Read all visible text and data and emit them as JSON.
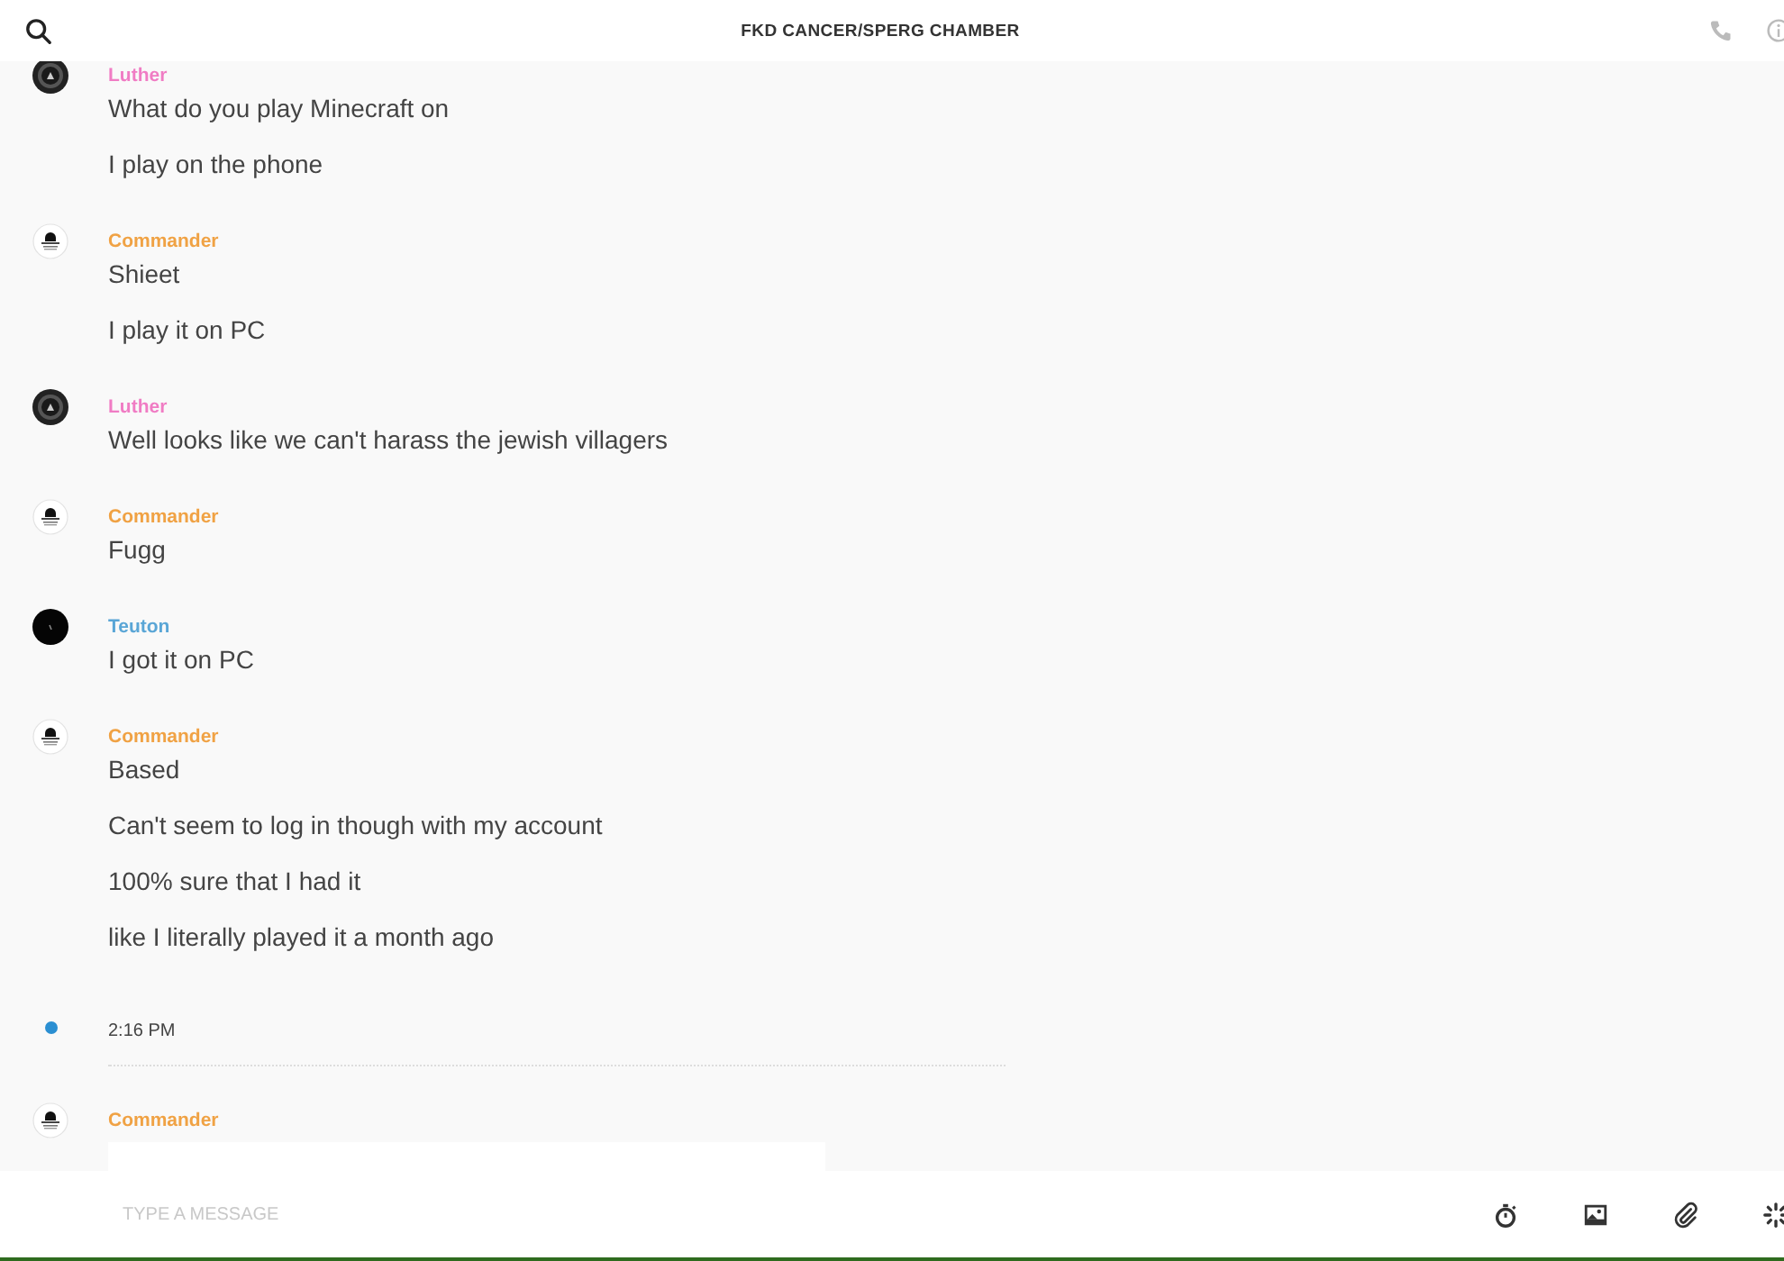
{
  "header": {
    "title": "FKD CANCER/SPERG CHAMBER"
  },
  "feed": [
    {
      "kind": "group",
      "author": "Luther",
      "color": "#f07cc4",
      "avatar": {
        "kind": "ring"
      },
      "messages": [
        {
          "kind": "text",
          "text": "What do you play Minecraft on"
        },
        {
          "kind": "text",
          "text": "I play on the phone"
        }
      ]
    },
    {
      "kind": "group",
      "author": "Commander",
      "color": "#f0a244",
      "avatar": {
        "kind": "figure"
      },
      "messages": [
        {
          "kind": "text",
          "text": "Shieet"
        },
        {
          "kind": "text",
          "text": "I play it on PC"
        }
      ]
    },
    {
      "kind": "group",
      "author": "Luther",
      "color": "#f07cc4",
      "avatar": {
        "kind": "ring"
      },
      "messages": [
        {
          "kind": "text",
          "text": "Well looks like we can't harass the jewish villagers"
        }
      ]
    },
    {
      "kind": "group",
      "author": "Commander",
      "color": "#f0a244",
      "avatar": {
        "kind": "figure"
      },
      "messages": [
        {
          "kind": "text",
          "text": "Fugg"
        }
      ]
    },
    {
      "kind": "group",
      "author": "Teuton",
      "color": "#5aa6d6",
      "avatar": {
        "kind": "dark"
      },
      "messages": [
        {
          "kind": "text",
          "text": "I got it on PC"
        }
      ]
    },
    {
      "kind": "group",
      "author": "Commander",
      "color": "#f0a244",
      "avatar": {
        "kind": "figure"
      },
      "messages": [
        {
          "kind": "text",
          "text": "Based"
        },
        {
          "kind": "text",
          "text": "Can't seem to log in though with my account"
        },
        {
          "kind": "text",
          "text": "100% sure that I had it"
        },
        {
          "kind": "text",
          "text": "like I literally played it a month ago"
        }
      ]
    },
    {
      "kind": "time",
      "text": "2:16 PM"
    },
    {
      "kind": "group",
      "author": "Commander",
      "color": "#f0a244",
      "avatar": {
        "kind": "figure"
      },
      "messages": [
        {
          "kind": "image"
        }
      ]
    }
  ],
  "composer": {
    "placeholder": "TYPE A MESSAGE"
  }
}
